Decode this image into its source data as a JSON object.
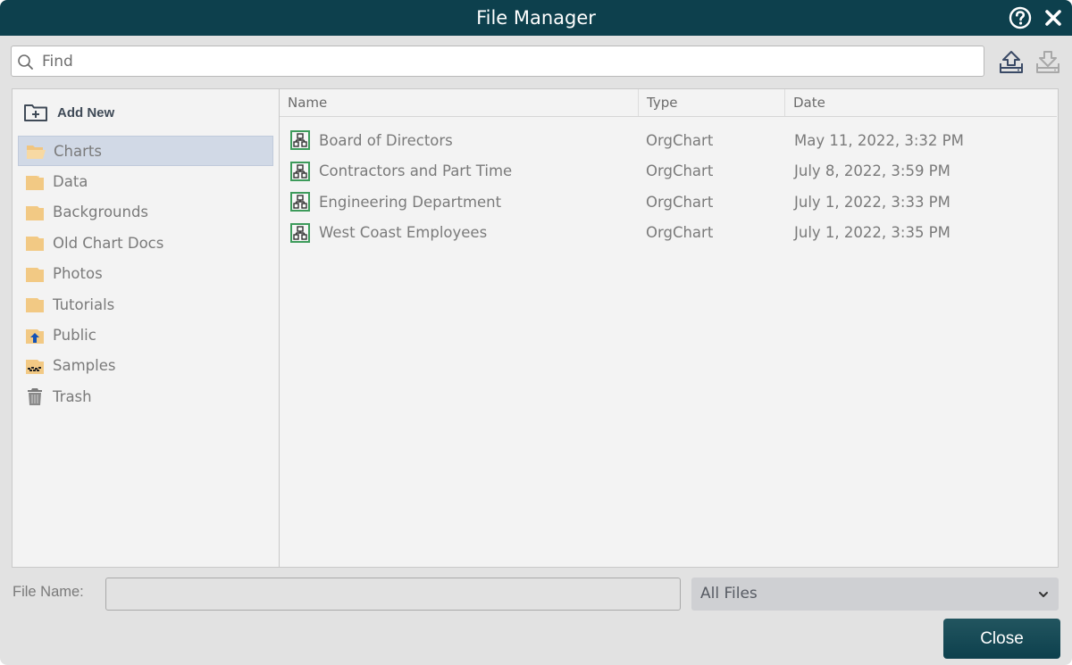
{
  "window": {
    "title": "File Manager",
    "help_icon": "help-circle-icon",
    "close_icon": "close-x-icon"
  },
  "search": {
    "placeholder": "Find",
    "value": "",
    "icon": "search-icon"
  },
  "toolbar": {
    "upload_icon": "upload-tray-icon",
    "download_icon": "download-tray-icon"
  },
  "sidebar": {
    "add_new_label": "Add New",
    "folders": [
      {
        "label": "Charts",
        "icon": "folder-open-icon",
        "selected": true
      },
      {
        "label": "Data",
        "icon": "folder-icon"
      },
      {
        "label": "Backgrounds",
        "icon": "folder-icon"
      },
      {
        "label": "Old Chart Docs",
        "icon": "folder-icon"
      },
      {
        "label": "Photos",
        "icon": "folder-icon"
      },
      {
        "label": "Tutorials",
        "icon": "folder-icon"
      },
      {
        "label": "Public",
        "icon": "folder-public-icon"
      },
      {
        "label": "Samples",
        "icon": "folder-samples-icon"
      },
      {
        "label": "Trash",
        "icon": "trash-icon"
      }
    ]
  },
  "table": {
    "columns": [
      "Name",
      "Type",
      "Date"
    ],
    "rows": [
      {
        "name": "Board of Directors",
        "type": "OrgChart",
        "date": "May 11, 2022, 3:32 PM"
      },
      {
        "name": "Contractors and Part Time",
        "type": "OrgChart",
        "date": "July 8, 2022, 3:59 PM"
      },
      {
        "name": "Engineering Department",
        "type": "OrgChart",
        "date": "July 1, 2022, 3:33 PM"
      },
      {
        "name": "West Coast Employees",
        "type": "OrgChart",
        "date": "July 1, 2022, 3:35 PM"
      }
    ]
  },
  "footer": {
    "file_name_label": "File Name:",
    "file_name_value": "",
    "filter_selected": "All Files",
    "close_label": "Close"
  },
  "colors": {
    "titlebar": "#0d404d",
    "folder": "#f2c984",
    "selected_row": "#d1d9e6",
    "orgchart_icon": "#3d9b5b"
  }
}
